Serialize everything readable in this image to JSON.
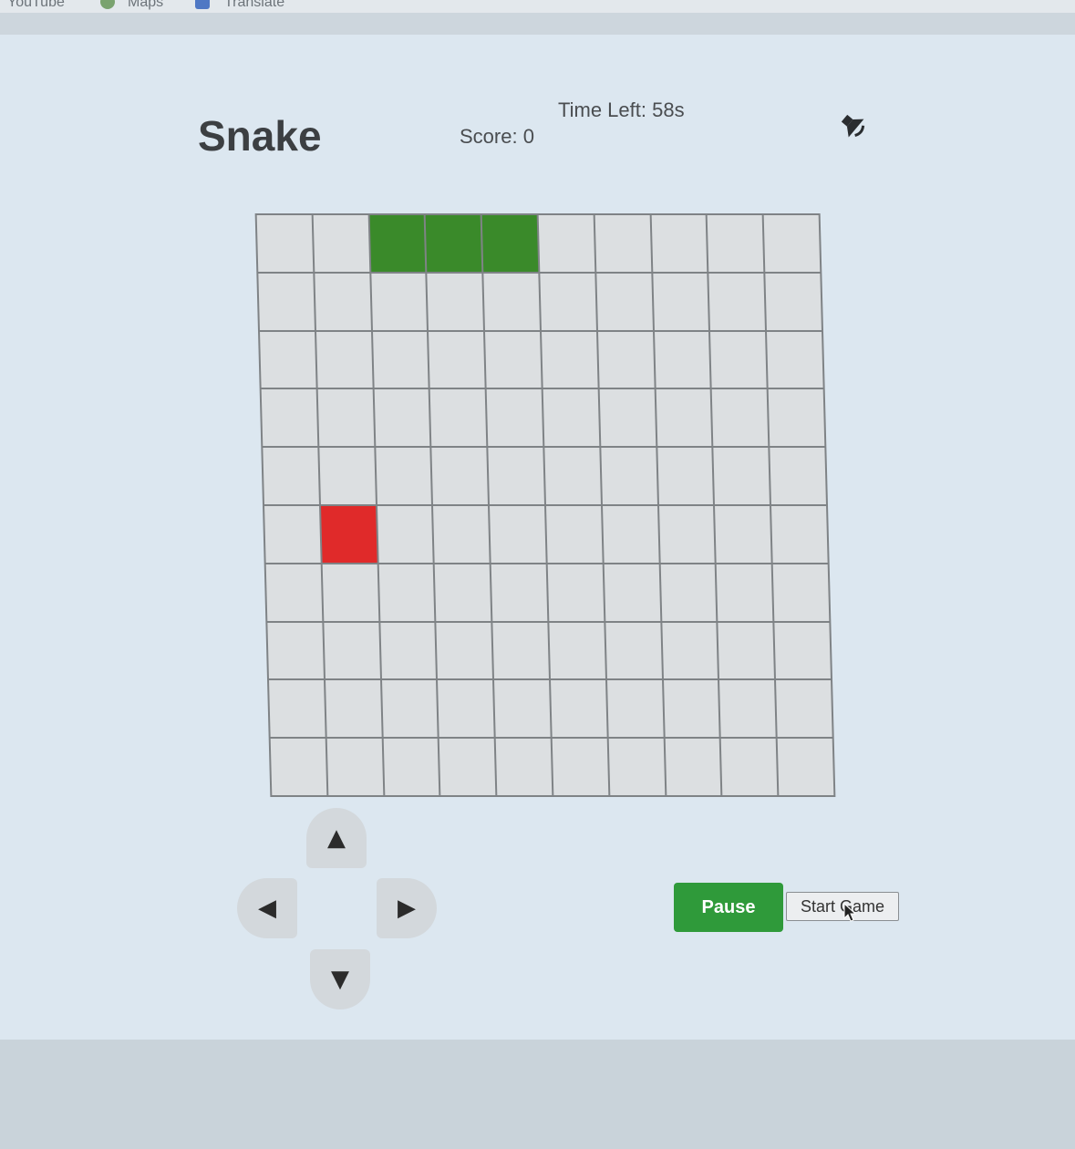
{
  "browser": {
    "bookmarks": [
      "YouTube",
      "Maps",
      "Translate"
    ]
  },
  "game": {
    "title": "Snake",
    "score_text": "Score: 0",
    "time_text": "Time Left: 58s",
    "sound_icon": "speaker-icon",
    "grid": {
      "rows": 10,
      "cols": 10,
      "snake": [
        [
          0,
          2
        ],
        [
          0,
          3
        ],
        [
          0,
          4
        ]
      ],
      "food": [
        [
          5,
          1
        ]
      ]
    },
    "controls": {
      "up": "▲",
      "left": "◀",
      "right": "▶",
      "down": "▼"
    },
    "pause_label": "Pause",
    "start_label": "Start Game"
  },
  "colors": {
    "snake": "#3a8a2a",
    "food": "#e02a2a",
    "pause_button": "#2f9a3a"
  }
}
